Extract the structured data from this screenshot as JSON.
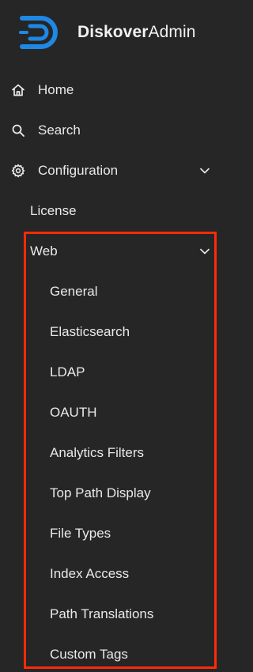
{
  "brand": {
    "name_bold": "Diskover",
    "name_light": "Admin",
    "logo_icon": "diskover-logo-icon",
    "logo_color": "#1e88e5"
  },
  "nav": {
    "home": {
      "label": "Home",
      "icon": "home-icon"
    },
    "search": {
      "label": "Search",
      "icon": "search-icon"
    },
    "configuration": {
      "label": "Configuration",
      "icon": "gear-icon",
      "expanded": true
    },
    "license": {
      "label": "License"
    },
    "web": {
      "label": "Web",
      "expanded": true,
      "items": [
        "General",
        "Elasticsearch",
        "LDAP",
        "OAUTH",
        "Analytics Filters",
        "Top Path Display",
        "File Types",
        "Index Access",
        "Path Translations",
        "Custom Tags"
      ]
    }
  },
  "colors": {
    "background": "#262626",
    "text": "#e9e9e9",
    "highlight": "#ff2a0a"
  }
}
